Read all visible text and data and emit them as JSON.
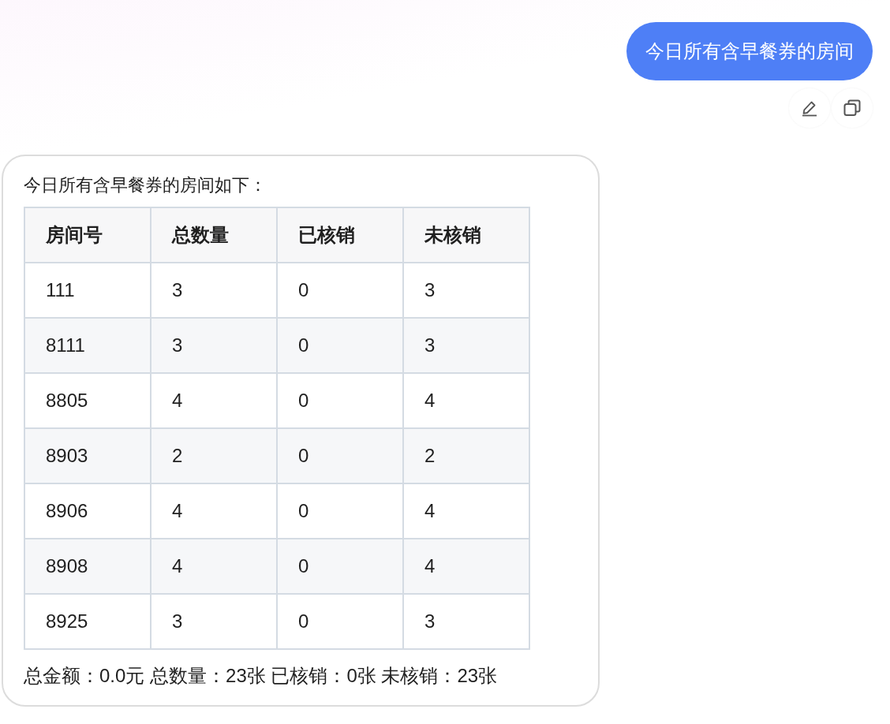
{
  "user_message": {
    "text": "今日所有含早餐券的房间"
  },
  "reply": {
    "intro": "今日所有含早餐券的房间如下：",
    "table": {
      "columns": [
        "房间号",
        "总数量",
        "已核销",
        "未核销"
      ],
      "rows": [
        [
          "111",
          "3",
          "0",
          "3"
        ],
        [
          "8111",
          "3",
          "0",
          "3"
        ],
        [
          "8805",
          "4",
          "0",
          "4"
        ],
        [
          "8903",
          "2",
          "0",
          "2"
        ],
        [
          "8906",
          "4",
          "0",
          "4"
        ],
        [
          "8908",
          "4",
          "0",
          "4"
        ],
        [
          "8925",
          "3",
          "0",
          "3"
        ]
      ]
    },
    "summary": "总金额：0.0元 总数量：23张 已核销：0张 未核销：23张"
  }
}
